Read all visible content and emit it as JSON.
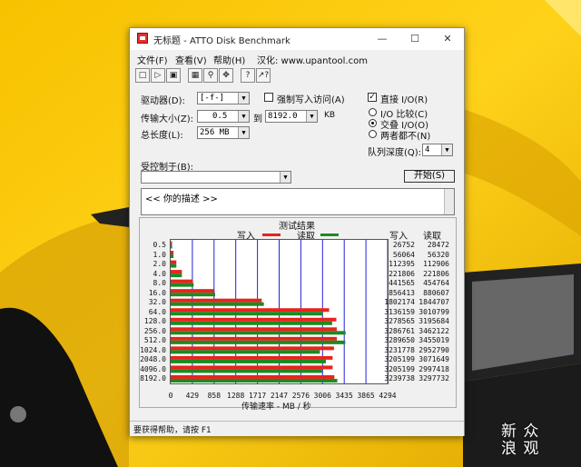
{
  "window": {
    "title": "无标题 - ATTO Disk Benchmark"
  },
  "menu": [
    {
      "label": "文件(F)"
    },
    {
      "label": "查看(V)"
    },
    {
      "label": "帮助(H)"
    },
    {
      "label": "汉化: www.upantool.com"
    }
  ],
  "toolbar": {
    "icons": [
      "new-icon",
      "open-icon",
      "save-icon",
      "print-icon",
      "print-preview-icon",
      "move-icon",
      "help-icon",
      "context-help-icon"
    ]
  },
  "settings": {
    "drive_label": "驱动器(D):",
    "drive_value": "[-f-]",
    "force_write_label": "强制写入访问(A)",
    "force_write_checked": false,
    "transfer_label": "传输大小(Z):",
    "transfer_from": "0.5",
    "to_label": "到",
    "transfer_to": "8192.0",
    "kb_label": "KB",
    "length_label": "总长度(L):",
    "length_value": "256 MB",
    "direct_io_label": "直接 I/O(R)",
    "direct_io_checked": true,
    "io_compare_label": "I/O 比较(C)",
    "overlap_io_label": "交叠 I/O(O)",
    "neither_label": "两者都不(N)",
    "queue_label": "队列深度(Q):",
    "queue_value": "4",
    "controlled_label": "受控制于(B):",
    "controlled_value": "",
    "start_label": "开始(S)",
    "description": "<<   你的描述   >>"
  },
  "results": {
    "title": "测试结果",
    "write_legend": "写入",
    "read_legend": "读取",
    "write_header": "写入",
    "read_header": "读取",
    "axis_label": "传输速率 - MB / 秒",
    "colors": {
      "write": "#e8231d",
      "read": "#1c8a22",
      "grid": "#2121d6"
    }
  },
  "chart_data": {
    "type": "bar",
    "orientation": "horizontal",
    "categories": [
      "0.5",
      "1.0",
      "2.0",
      "4.0",
      "8.0",
      "16.0",
      "32.0",
      "64.0",
      "128.0",
      "256.0",
      "512.0",
      "1024.0",
      "2048.0",
      "4096.0",
      "8192.0"
    ],
    "series": [
      {
        "name": "写入",
        "values": [
          26752,
          56064,
          112395,
          221806,
          441565,
          856413,
          1802174,
          3136159,
          3278565,
          3286761,
          3289650,
          3231778,
          3205199,
          3205199,
          3239738
        ]
      },
      {
        "name": "读取",
        "values": [
          28472,
          56320,
          112906,
          221806,
          454764,
          880607,
          1844707,
          3010799,
          3195684,
          3462122,
          3455019,
          2952790,
          3071649,
          2997418,
          3297732
        ]
      }
    ],
    "x_ticks": [
      "0",
      "429",
      "858",
      "1288",
      "1717",
      "2147",
      "2576",
      "3006",
      "3435",
      "3865",
      "4294"
    ],
    "xlim": [
      0,
      4294
    ],
    "xlabel": "传输速率 - MB / 秒",
    "grid": true,
    "legend": "top"
  },
  "status": {
    "text": "要获得帮助，请按 F1"
  },
  "watermark": {
    "line1": "新 众",
    "line2": "浪 观"
  }
}
